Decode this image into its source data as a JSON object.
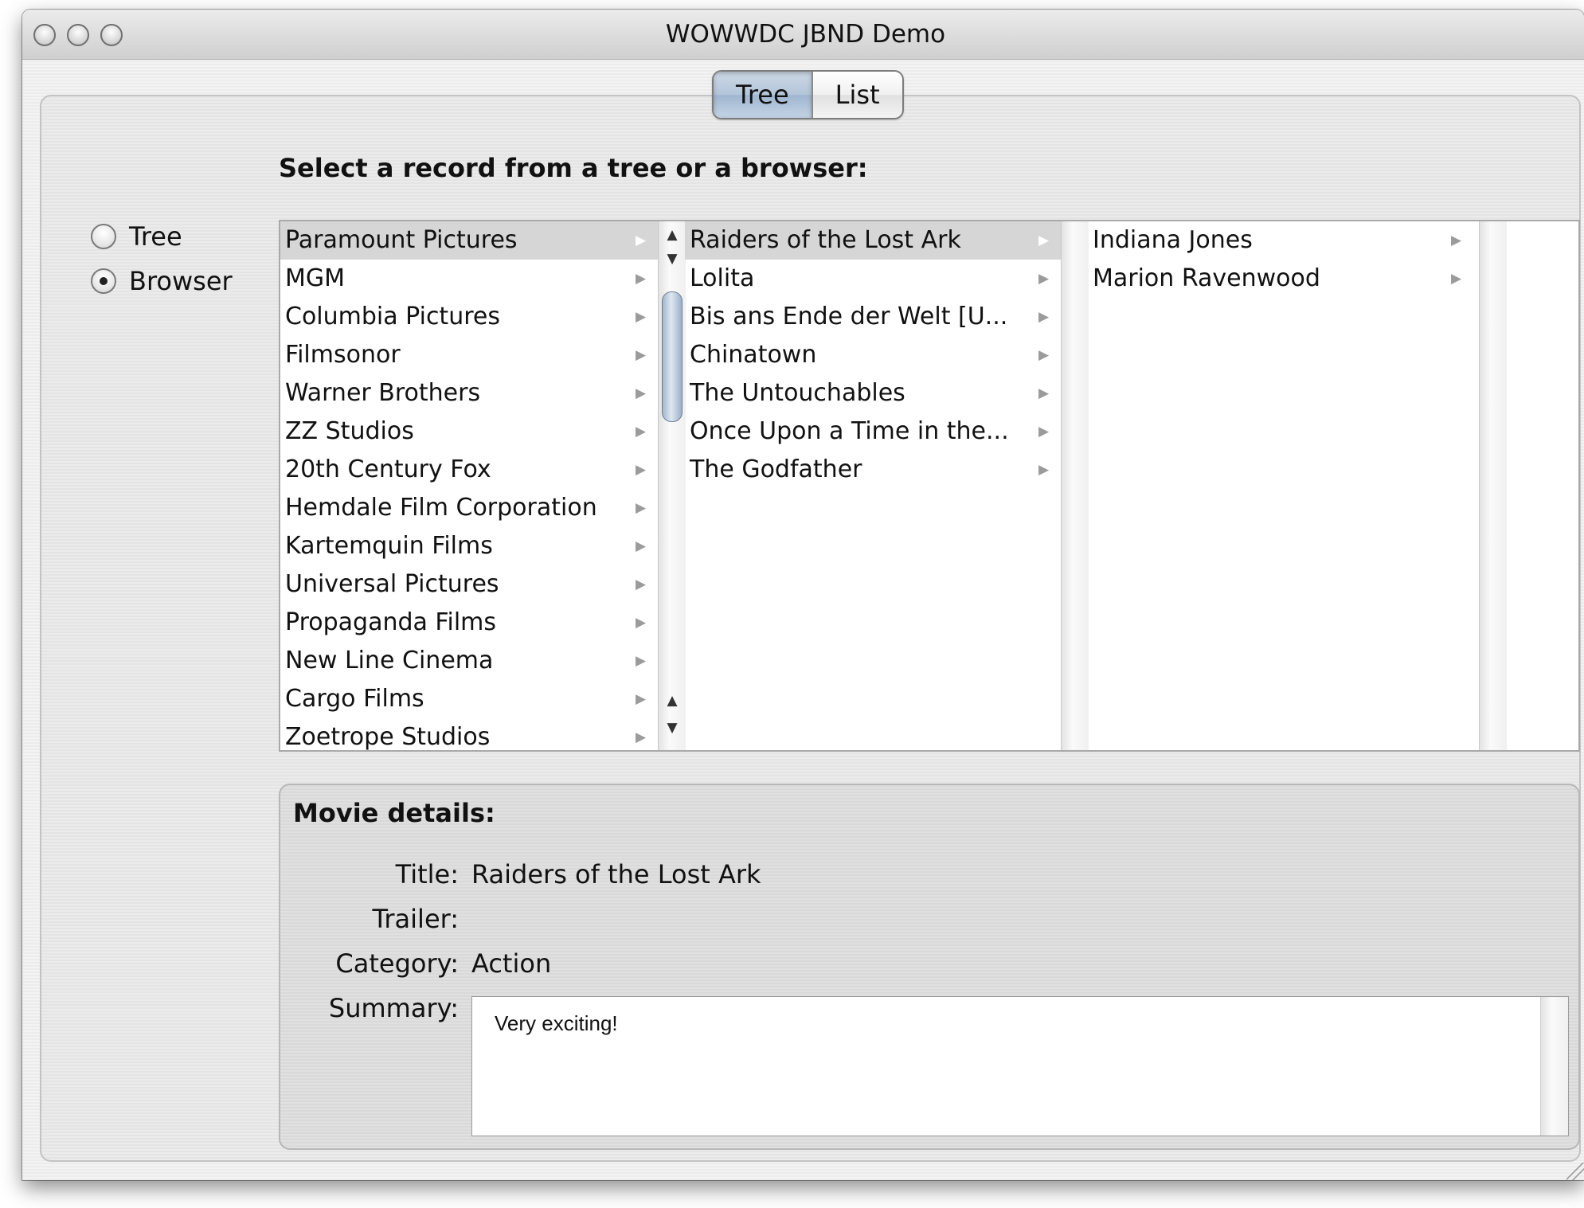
{
  "window": {
    "title": "WOWWDC JBND Demo"
  },
  "view_tabs": [
    {
      "label": "Tree",
      "selected": true
    },
    {
      "label": "List",
      "selected": false
    }
  ],
  "instruction": "Select a record from a tree or a browser:",
  "mode_radios": [
    {
      "label": "Tree",
      "checked": false
    },
    {
      "label": "Browser",
      "checked": true
    }
  ],
  "browser": {
    "column1": [
      "Paramount Pictures",
      "MGM",
      "Columbia Pictures",
      "Filmsonor",
      "Warner Brothers",
      "ZZ Studios",
      "20th Century Fox",
      "Hemdale Film Corporation",
      "Kartemquin Films",
      "Universal Pictures",
      "Propaganda Films",
      "New Line Cinema",
      "Cargo Films",
      "Zoetrope Studios"
    ],
    "column1_selected_index": 0,
    "column2": [
      "Raiders of the Lost Ark",
      "Lolita",
      "Bis ans Ende der Welt [U...",
      "Chinatown",
      "The Untouchables",
      "Once Upon a Time in the...",
      "The Godfather"
    ],
    "column2_selected_index": 0,
    "column3": [
      "Indiana Jones",
      "Marion Ravenwood"
    ],
    "arrow_glyph": "▶",
    "scroll_up_glyph": "▲",
    "scroll_down_glyph": "▼"
  },
  "details": {
    "heading": "Movie details:",
    "title_label": "Title:",
    "title_value": "Raiders of the Lost Ark",
    "trailer_label": "Trailer:",
    "trailer_value": "",
    "category_label": "Category:",
    "category_value": "Action",
    "summary_label": "Summary:",
    "summary_value": "Very exciting!"
  },
  "colors": {
    "selected_row": "#d6d6d6",
    "selected_segment": "#b3c5d9"
  }
}
